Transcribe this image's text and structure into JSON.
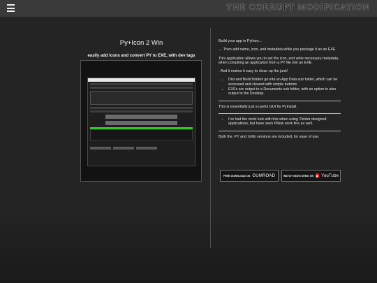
{
  "header": {
    "site_title": "THE CORRUPT MODIFICATION",
    "menu_icon": "hamburger-icon"
  },
  "product": {
    "title": "Py+Icon 2 Win",
    "subtitle": "easily add icons and convert PY to EXE, with dev tags"
  },
  "description": {
    "p1": "Build your app in Python...",
    "p2": "→ Then add name, icon, and metadata while you package it as an EXE",
    "p3": "This application allows you to set the icon, and write necessary metadata, when compiling an application from a PY file into an EXE.",
    "p4": "- And it makes it easy to clean up the junk!",
    "bullets1": [
      "Dist and Build folders go into an App Data sub folder, which can be accessed and cleared with simple buttons.",
      "EXEs are output to a Documents sub folder, with an option to also output to the Desktop."
    ],
    "p5": "This is essentially just a useful GUI for PyInstall.",
    "bullets2": [
      "I've had the most luck with this when using Tkinter designed applications, but have seen Pillow work fine as well."
    ],
    "p6": "Both the .PY and .EXE versions are included, for ease of use."
  },
  "buttons": {
    "gumroad_prefix": "FREE DOWNLOAD ON",
    "gumroad_brand": "GUMROAD",
    "youtube_prefix": "WATCH VIDEO DEMO ON",
    "youtube_brand": "YouTube"
  },
  "colors": {
    "background": "#242424",
    "topbar": "#3a3a3a",
    "progress_green": "#2ec82e"
  }
}
